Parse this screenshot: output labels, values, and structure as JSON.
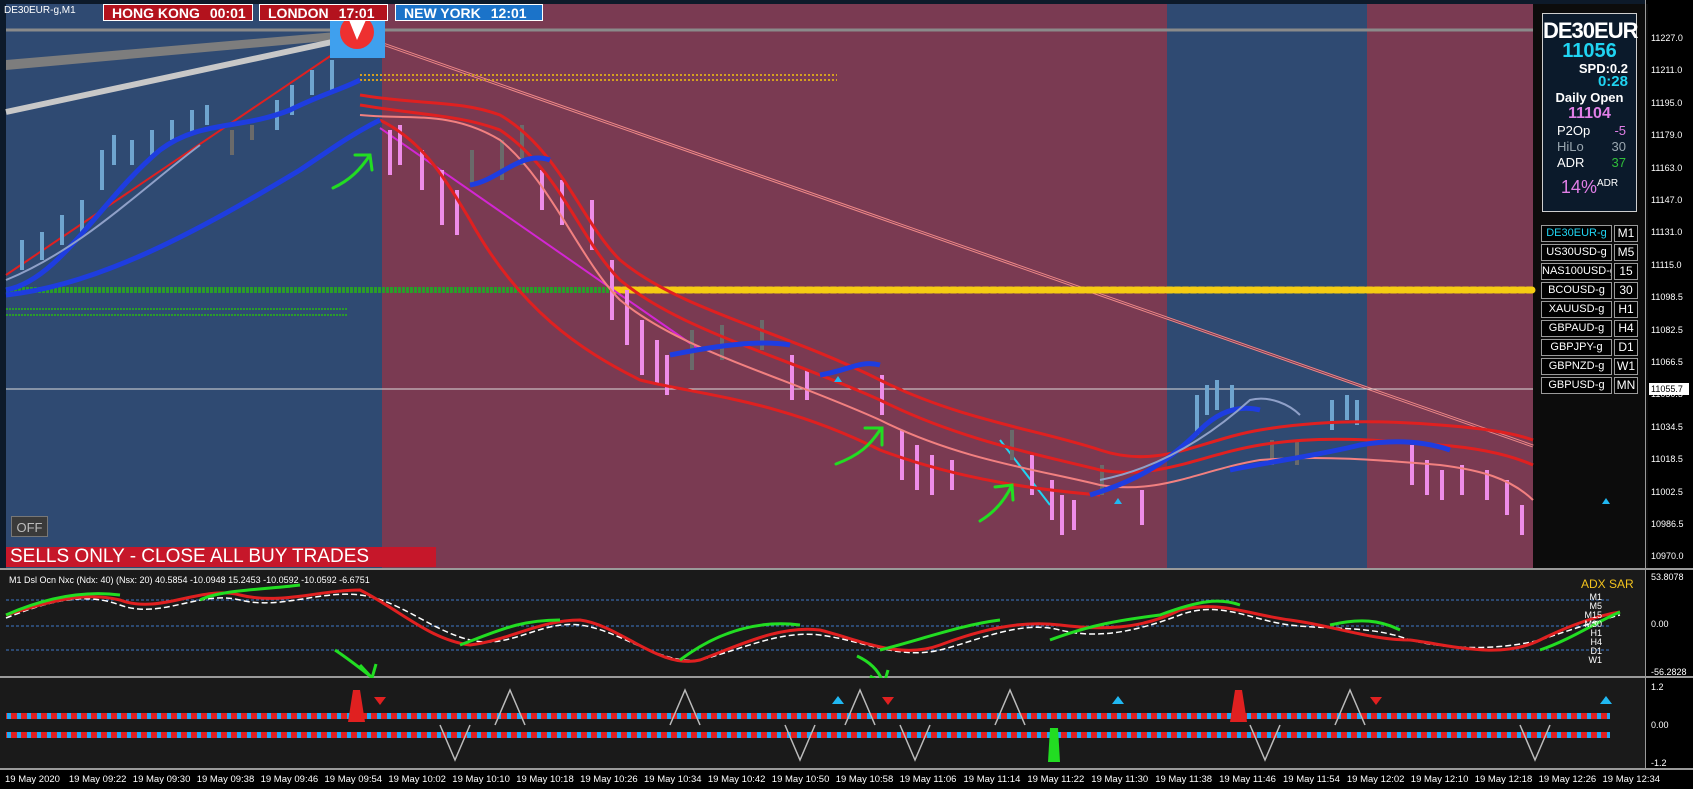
{
  "chart_title": "DE30EUR-g,M1",
  "sessions": [
    {
      "name": "HONG KONG",
      "time": "00:01",
      "color": "#b3121d"
    },
    {
      "name": "LONDON",
      "time": "17:01",
      "color": "#b3121d"
    },
    {
      "name": "NEW YORK",
      "time": "12:01",
      "color": "#1b73c9"
    }
  ],
  "off_button": "OFF",
  "sell_banner": "SELLS ONLY - CLOSE ALL BUY TRADES",
  "info_panel": {
    "symbol": "DE30EUR",
    "price": "11056",
    "spread": "SPD:0.2",
    "timer": "0:28",
    "daily_open_label": "Daily Open",
    "daily_open_value": "11104",
    "rows": [
      {
        "label": "P2Op",
        "value": "-5",
        "color": "#e07ee6"
      },
      {
        "label": "HiLo",
        "value": "30",
        "color": "#9aa7b0"
      },
      {
        "label": "ADR",
        "value": "37",
        "color": "#2fbf3a"
      }
    ],
    "adr_percent": "14%",
    "adr_suffix": "ADR"
  },
  "symbol_list": [
    {
      "symbol": "DE30EUR-g",
      "tf": "M1"
    },
    {
      "symbol": "US30USD-g",
      "tf": "M5"
    },
    {
      "symbol": "NAS100USD-g",
      "tf": "15"
    },
    {
      "symbol": "BCOUSD-g",
      "tf": "30"
    },
    {
      "symbol": "XAUUSD-g",
      "tf": "H1"
    },
    {
      "symbol": "GBPAUD-g",
      "tf": "H4"
    },
    {
      "symbol": "GBPJPY-g",
      "tf": "D1"
    },
    {
      "symbol": "GBPNZD-g",
      "tf": "W1"
    },
    {
      "symbol": "GBPUSD-g",
      "tf": "MN"
    }
  ],
  "price_axis": [
    "11227.0",
    "11211.0",
    "11195.0",
    "11179.0",
    "11163.0",
    "11147.0",
    "11131.0",
    "11115.0",
    "11098.5",
    "11082.5",
    "11066.5",
    "11050.5",
    "11034.5",
    "11018.5",
    "11002.5",
    "10986.5",
    "10970.0"
  ],
  "current_price_tag": "11055.7",
  "indicator": {
    "label": "M1 Dsl Ocn Nxc (Ndx: 40) (Nsx: 20) 40.5854 -10.0948 15.2453 -10.0592 -10.0592 -6.6751",
    "adx_sar_label": "ADX SAR",
    "timeframes": [
      "M1",
      "M5",
      "M15",
      "M30",
      "H1",
      "H4",
      "D1",
      "W1"
    ],
    "scale_top": "53.8078",
    "scale_zero": "0.00",
    "scale_bottom": "-56.2828"
  },
  "lower_indicator": {
    "scale_top": "1.2",
    "scale_zero": "0.00",
    "scale_bottom": "-1.2"
  },
  "time_axis": [
    "19 May 2020",
    "19 May 09:22",
    "19 May 09:30",
    "19 May 09:38",
    "19 May 09:46",
    "19 May 09:54",
    "19 May 10:02",
    "19 May 10:10",
    "19 May 10:18",
    "19 May 10:26",
    "19 May 10:34",
    "19 May 10:42",
    "19 May 10:50",
    "19 May 10:58",
    "19 May 11:06",
    "19 May 11:14",
    "19 May 11:22",
    "19 May 11:30",
    "19 May 11:38",
    "19 May 11:46",
    "19 May 11:54",
    "19 May 12:02",
    "19 May 12:10",
    "19 May 12:18",
    "19 May 12:26",
    "19 May 12:34"
  ]
}
